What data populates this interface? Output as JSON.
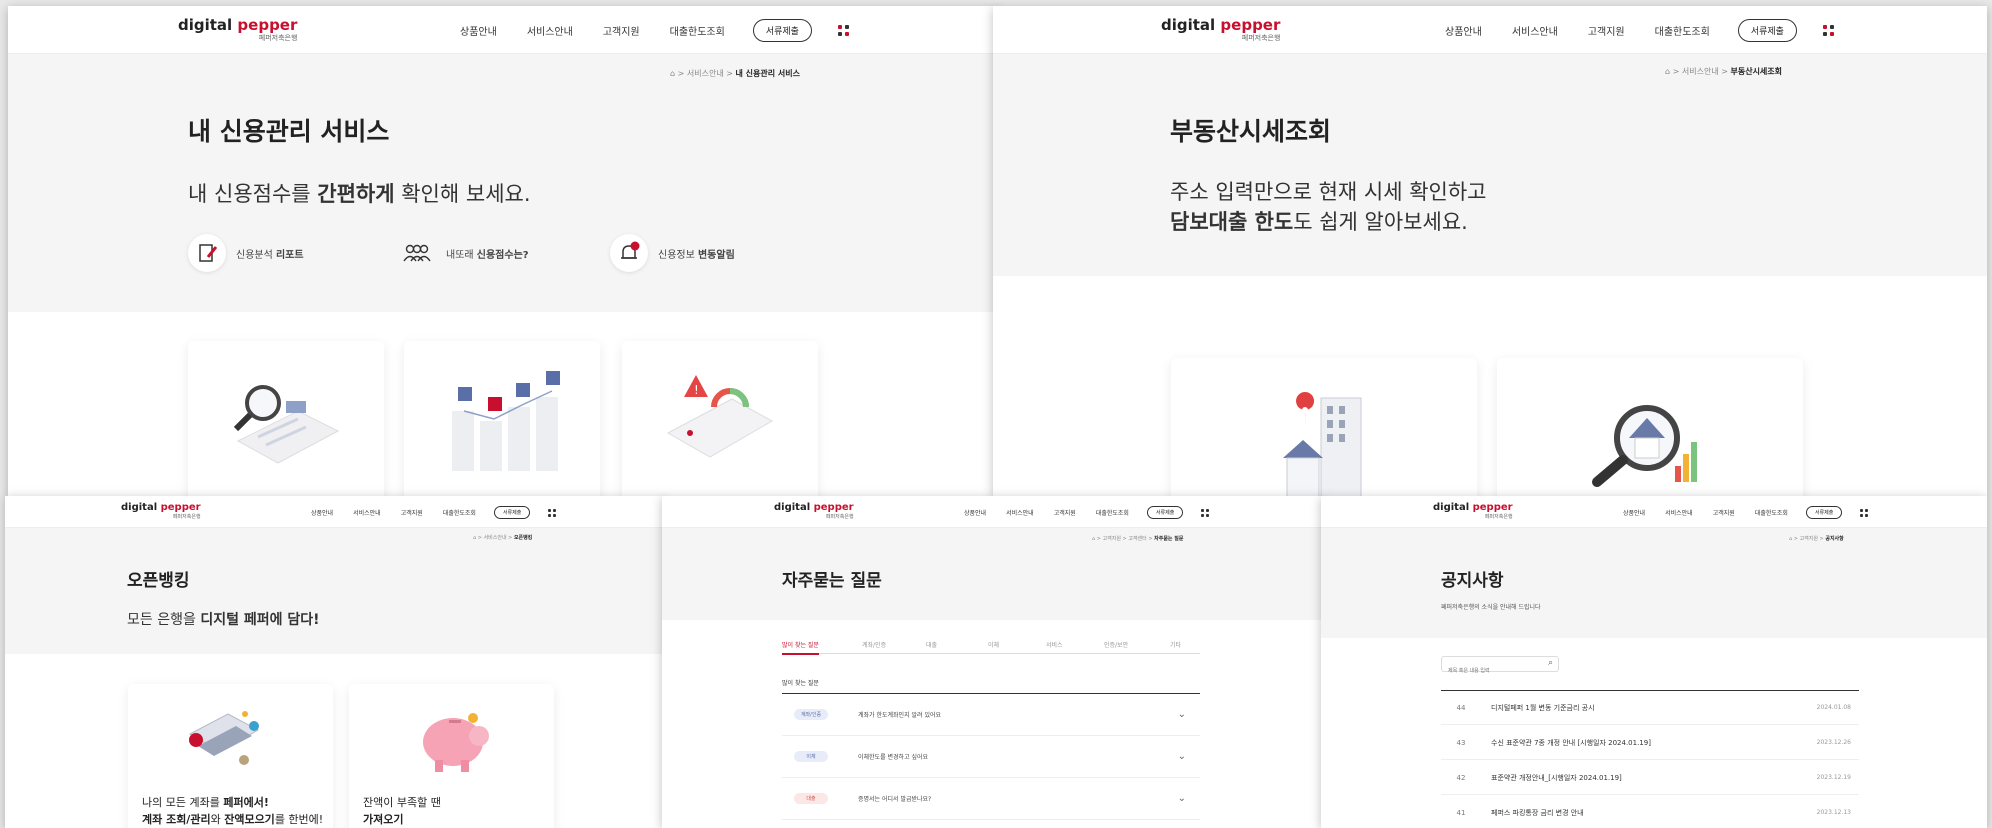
{
  "brand": {
    "name_a": "digital ",
    "name_b": "pepper",
    "sub": "페퍼저축은행",
    "accent": "#c8102e"
  },
  "nav": {
    "items": [
      "상품안내",
      "서비스안내",
      "고객지원",
      "대출한도조회"
    ],
    "button": "서류제출"
  },
  "credit": {
    "breadcrumb": {
      "section": "서비스안내",
      "current": "내 신용관리 서비스"
    },
    "title": "내 신용관리 서비스",
    "lead_a": "내 신용점수를 ",
    "lead_b": "간편하게",
    "lead_c": " 확인해 보세요.",
    "features": [
      {
        "icon": "report-icon",
        "a": "신용분석 ",
        "b": "리포트"
      },
      {
        "icon": "people-icon",
        "a": "내또래 ",
        "b": "신용점수는?"
      },
      {
        "icon": "bell-icon",
        "a": "신용정보 ",
        "b": "변동알림"
      }
    ]
  },
  "realestate": {
    "breadcrumb": {
      "section": "서비스안내",
      "current": "부동산시세조회"
    },
    "title": "부동산시세조회",
    "line1": "주소 입력만으로 현재 시세 확인하고",
    "line2_bold": "담보대출 한도",
    "line2_rest": "도 쉽게 알아보세요."
  },
  "openbanking": {
    "breadcrumb": {
      "section": "서비스안내",
      "current": "오픈뱅킹"
    },
    "title": "오픈뱅킹",
    "lead_a": "모든 은행을 ",
    "lead_b": "디지털 페퍼에 담다!",
    "card1_l1a": "나의 모든 계좌를 ",
    "card1_l1b": "페퍼에서!",
    "card1_l2a": "계좌 조회/관리",
    "card1_l2b": "와 ",
    "card1_l2c": "잔액모으기",
    "card1_l2d": "를 한번에!",
    "card2_l1": "잔액이 부족할 땐",
    "card2_l2": "가져오기"
  },
  "faq": {
    "breadcrumb": {
      "section1": "고객지원",
      "section2": "고객센터",
      "current": "자주묻는 질문"
    },
    "title": "자주묻는 질문",
    "tabs": [
      "많이 찾는 질문",
      "계좌/인증",
      "대출",
      "이체",
      "서비스",
      "인증/보안",
      "기타"
    ],
    "list_header": "많이 찾는 질문",
    "rows": [
      {
        "chip": "계좌/인증",
        "q": "계좌가 한도계좌인지 알려 있어요"
      },
      {
        "chip": "이체",
        "q": "이체한도를 변경하고 싶어요"
      },
      {
        "chip": "대출",
        "q": "증명서는 어디서 발급받나요?"
      }
    ]
  },
  "notice": {
    "breadcrumb": {
      "section": "고객지원",
      "current": "공지사항"
    },
    "title": "공지사항",
    "subtitle": "페퍼저축은행의 소식을 안내해 드립니다",
    "search_placeholder": "제목 혹은 내용 입력",
    "rows": [
      {
        "no": "44",
        "title": "디지털페퍼 1월 변동 기준금리 공시",
        "date": "2024.01.08"
      },
      {
        "no": "43",
        "title": "수신 표준약관 7종 개정 안내 [시행일자 2024.01.19]",
        "date": "2023.12.26"
      },
      {
        "no": "42",
        "title": "표준약관 개정안내_[시행일자 2024.01.19]",
        "date": "2023.12.19"
      },
      {
        "no": "41",
        "title": "페퍼스 파킹통장 금리 변경 안내",
        "date": "2023.12.13"
      }
    ]
  }
}
